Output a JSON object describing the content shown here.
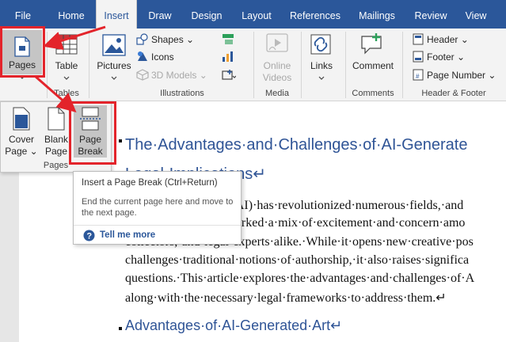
{
  "tabs": [
    {
      "label": "File"
    },
    {
      "label": "Home"
    },
    {
      "label": "Insert"
    },
    {
      "label": "Draw"
    },
    {
      "label": "Design"
    },
    {
      "label": "Layout"
    },
    {
      "label": "References"
    },
    {
      "label": "Mailings"
    },
    {
      "label": "Review"
    },
    {
      "label": "View"
    }
  ],
  "ribbon": {
    "pages_label": "Pages",
    "table_label": "Table",
    "tables_group": "Tables",
    "pictures_label": "Pictures",
    "shapes_label": "Shapes",
    "icons_label": "Icons",
    "models_label": "3D Models",
    "illustrations_group": "Illustrations",
    "online_videos_line1": "Online",
    "online_videos_line2": "Videos",
    "media_group": "Media",
    "links_label": "Links",
    "comment_label": "Comment",
    "comments_group": "Comments",
    "header_label": "Header",
    "footer_label": "Footer",
    "page_number_label": "Page Number",
    "header_footer_group": "Header & Footer"
  },
  "pages_menu": {
    "cover_line1": "Cover",
    "cover_line2": "Page",
    "blank_line1": "Blank",
    "blank_line2": "Page",
    "break_line1": "Page",
    "break_line2": "Break",
    "group_label": "Pages"
  },
  "tooltip": {
    "title": "Insert a Page Break (Ctrl+Return)",
    "description": "End the current page here and move to the next page.",
    "tell_me": "Tell me more"
  },
  "document": {
    "heading1_line1": "The·Advantages·and·Challenges·of·AI-Generate",
    "heading1_line2": "Legal·Implications↵",
    "body_lines": [
      "ce·(AI)·has·revolutionized·numerous·fields,·and",
      "s·sparked·a·mix·of·excitement·and·concern·amo",
      "collectors,·and·legal·experts·alike.·While·it·opens·new·creative·pos",
      "challenges·traditional·notions·of·authorship,·it·also·raises·significa",
      "questions.·This·article·explores·the·advantages·and·challenges·of·A",
      "along·with·the·necessary·legal·frameworks·to·address·them.↵"
    ],
    "heading2": "Advantages·of·AI-Generated·Art↵"
  },
  "colors": {
    "brand_blue": "#2b579a",
    "annotation_red": "#e3242b",
    "heading_blue": "#2f5496"
  }
}
